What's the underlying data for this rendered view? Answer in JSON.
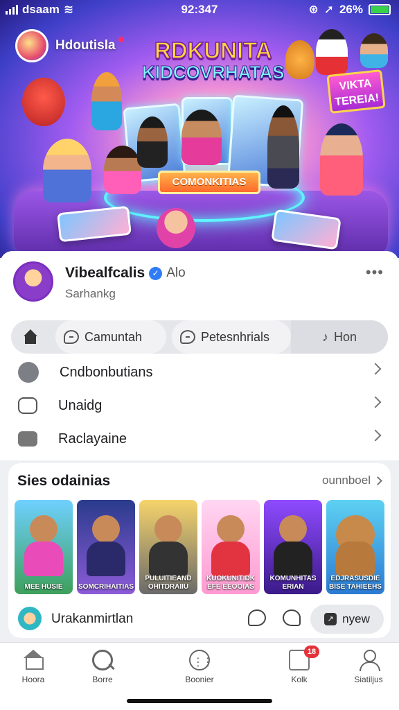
{
  "status": {
    "carrier": "dsaam",
    "time": "92:347",
    "battery": "26%"
  },
  "banner": {
    "brand_name": "Hdoutisla",
    "headline_1": "RDKUNITA",
    "headline_2": "KIDCOVRHATAS",
    "sign_text": "VIKTA TEREIA!",
    "ribbon_text": "COMONKITIAS"
  },
  "profile": {
    "name": "Vibealfcalis",
    "meta": "Alo",
    "subtitle": "Sarhankg"
  },
  "tabs": [
    {
      "label": "Camuntah"
    },
    {
      "label": "Petesnhrials"
    },
    {
      "label": "Hon"
    }
  ],
  "menu": [
    {
      "label": "Cndbonbutians"
    },
    {
      "label": "Unaidg"
    },
    {
      "label": "Raclayaine"
    }
  ],
  "section": {
    "title": "Sies odainias",
    "more": "ounnboel",
    "thumbs": [
      {
        "caption": "MEE HUSIE"
      },
      {
        "caption": "SOMCRIHAITIAS"
      },
      {
        "caption": "PULUITIEAND OHITDRAIIU"
      },
      {
        "caption": "KUOKUNITIDK EFE EEOOIAS"
      },
      {
        "caption": "KOMUNHITAS ERIAN"
      },
      {
        "caption": "EDJRASUSDIE BISE TAHIEEHS"
      }
    ],
    "footer_text": "Urakanmirtlan",
    "footer_button": "nyew"
  },
  "bottom_nav": [
    {
      "label": "Hoora"
    },
    {
      "label": "Borre"
    },
    {
      "label": "Boonier"
    },
    {
      "label": "Kolk",
      "badge": "18"
    },
    {
      "label": "Siatiljus"
    }
  ]
}
